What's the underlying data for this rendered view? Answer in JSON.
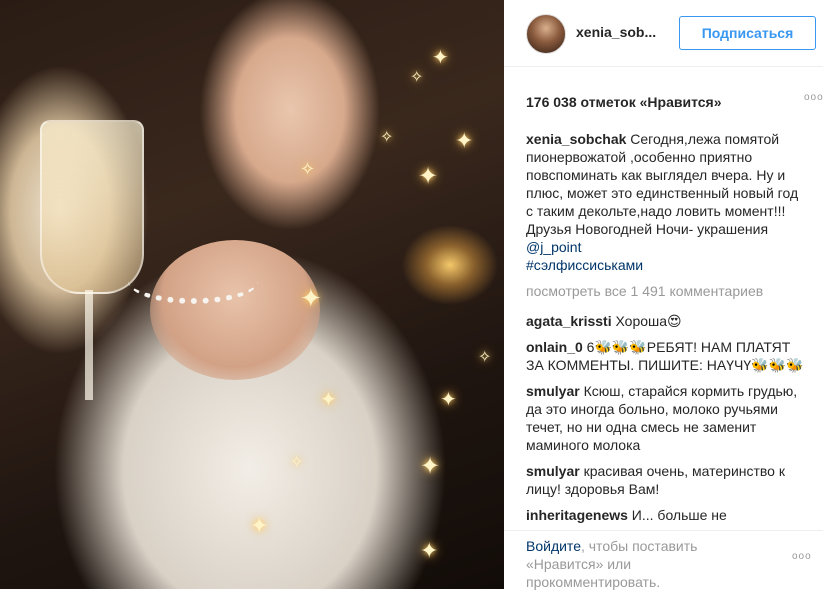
{
  "post": {
    "author": "xenia_sob...",
    "follow_label": "Подписаться",
    "likes": "176 038 отметок «Нравится»",
    "more": "ooo"
  },
  "caption": {
    "user": "xenia_sobchak",
    "text": " Сегодня,лежа помятой пионервожатой ,особенно приятно повспоминать как выглядел вчера. Ну и плюс, может это единственный новый год с таким декольте,надо ловить момент!!!Друзья Новогодней Ночи- украшения ",
    "mention": "@j_point",
    "hashtag": "#сэлфиссиськами"
  },
  "load_more": "посмотреть все 1 491 комментариев",
  "comments": [
    {
      "user": "agata_krissti",
      "text": " Хороша😍"
    },
    {
      "user": "onlain_0",
      "text": " 6🐝🐝🐝РЕБЯТ! НАМ ПЛАТЯТ ЗА КОММЕНТЫ. ПИШИТЕ: НАҮЧҮ🐝🐝🐝"
    },
    {
      "user": "smulyar",
      "text": " Ксюш, старайся кормить грудью, да это иногда больно, молоко ручьями течет, но ни одна смесь не заменит маминого молока"
    },
    {
      "user": "smulyar",
      "text": " красивая очень, материнство к лицу! здоровья Вам!"
    },
    {
      "user": "inheritagenews",
      "text": " И... больше не"
    }
  ],
  "footer": {
    "login": "Войдите",
    "rest": ", чтобы поставить «Нравится» или прокомментировать.",
    "more": "ooo"
  }
}
